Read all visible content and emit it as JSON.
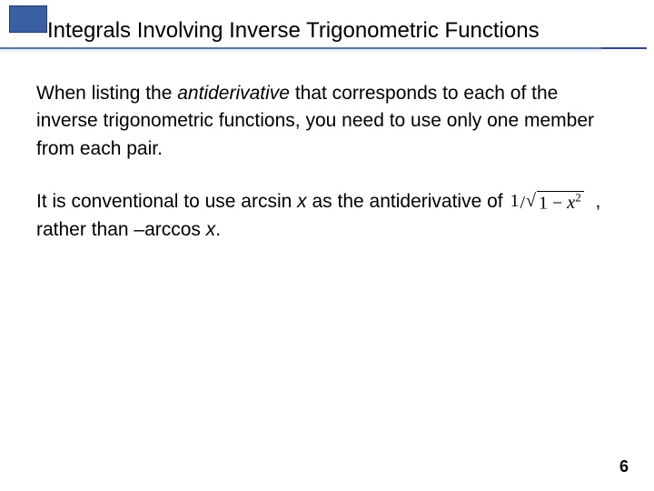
{
  "title": "Integrals Involving Inverse Trigonometric Functions",
  "body": {
    "p1_a": "When listing the ",
    "p1_em": "antiderivative",
    "p1_b": " that corresponds to each of the inverse trigonometric functions, you need to use only one member from each pair.",
    "p2_a": "It is conventional to use arcsin ",
    "p2_x1": "x",
    "p2_b": " as the antiderivative of ",
    "p2_math": {
      "one": "1",
      "radicand_pre": "1 − ",
      "radicand_x": "x",
      "radicand_sup": "2"
    },
    "p2_c": ", rather than –arccos ",
    "p2_x2": "x",
    "p2_d": "."
  },
  "page_number": "6"
}
